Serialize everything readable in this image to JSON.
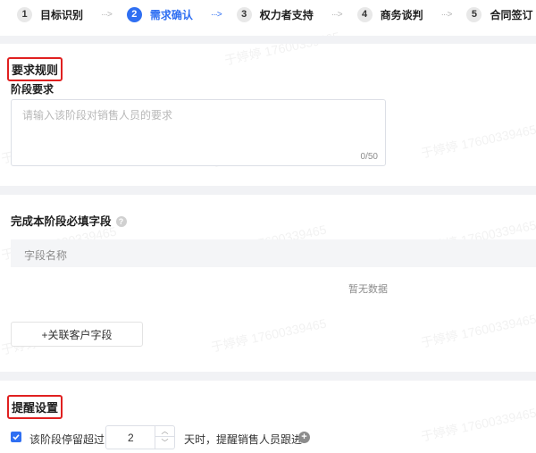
{
  "steps": [
    {
      "num": "1",
      "label": "目标识别"
    },
    {
      "num": "2",
      "label": "需求确认"
    },
    {
      "num": "3",
      "label": "权力者支持"
    },
    {
      "num": "4",
      "label": "商务谈判"
    },
    {
      "num": "5",
      "label": "合同签订"
    }
  ],
  "step_arrow": "···>",
  "requirements": {
    "section_title": "要求规则",
    "field_label": "阶段要求",
    "placeholder": "请输入该阶段对销售人员的要求",
    "counter": "0/50"
  },
  "required_fields": {
    "title": "完成本阶段必填字段",
    "column_header": "字段名称",
    "empty_text": "暂无数据",
    "link_button": "+关联客户字段"
  },
  "reminder": {
    "section_title": "提醒设置",
    "prefix": "该阶段停留超过",
    "days_value": "2",
    "suffix": "天时，提醒销售人员跟进"
  },
  "watermark_text": "于婷婷 17600339465",
  "colors": {
    "accent": "#2f6ff2",
    "highlight_box": "#e02020"
  }
}
